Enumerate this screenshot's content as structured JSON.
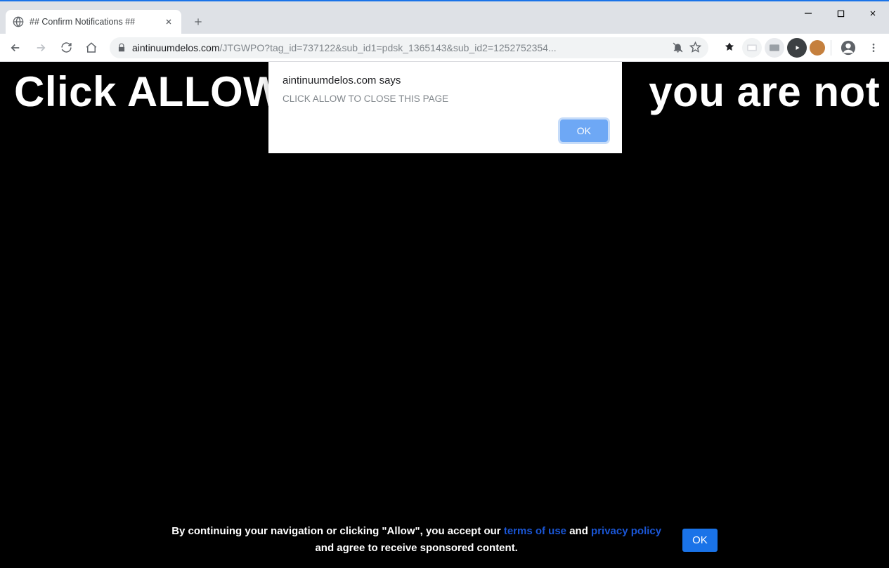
{
  "tab": {
    "title": "## Confirm Notifications ##"
  },
  "url": {
    "domain": "aintinuumdelos.com",
    "path": "/JTGWPO?tag_id=737122&sub_id1=pdsk_1365143&sub_id2=1252752354..."
  },
  "headline": {
    "left": "Click ALLOW",
    "right": "you are not"
  },
  "dialog": {
    "origin": "aintinuumdelos.com says",
    "message": "CLICK ALLOW TO CLOSE THIS PAGE",
    "ok": "OK"
  },
  "footer": {
    "line1_pre": "By continuing your navigation or clicking \"Allow\", you accept our ",
    "terms": "terms of use",
    "mid": " and ",
    "privacy": "privacy policy",
    "line2": "and agree to receive sponsored content.",
    "ok": "OK"
  }
}
